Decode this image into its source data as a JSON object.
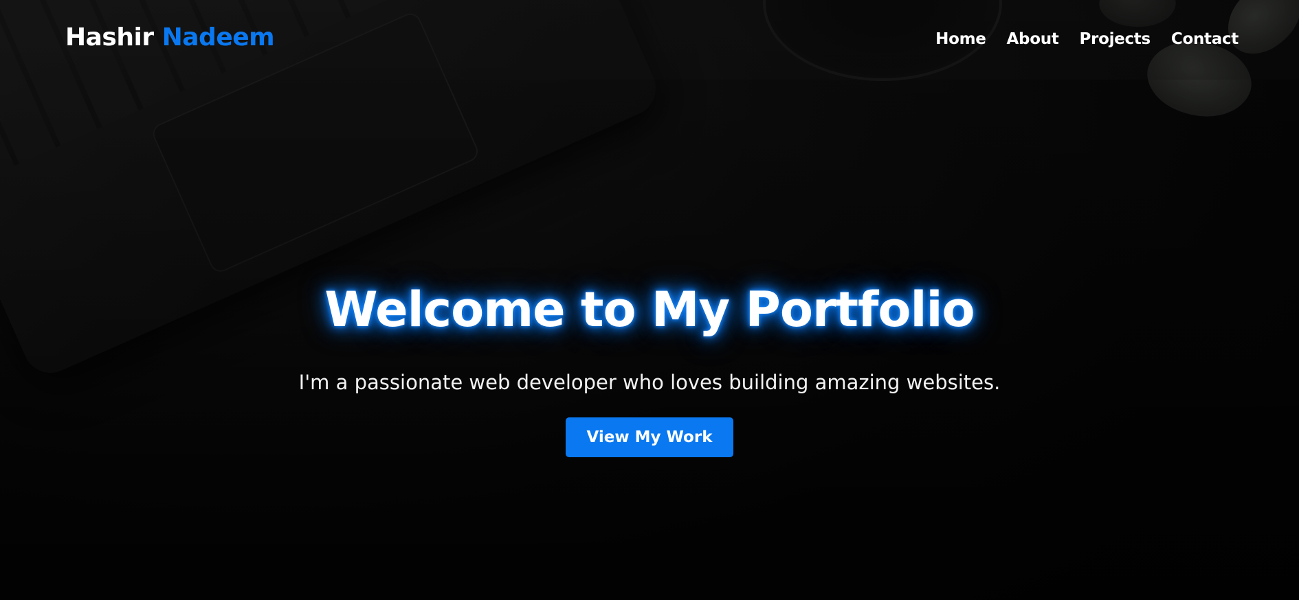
{
  "header": {
    "logo_first": "Hashir",
    "logo_second": "Nadeem",
    "nav": [
      {
        "label": "Home"
      },
      {
        "label": "About"
      },
      {
        "label": "Projects"
      },
      {
        "label": "Contact"
      }
    ]
  },
  "hero": {
    "title": "Welcome to My Portfolio",
    "subtitle": "I'm a passionate web developer who loves building amazing websites.",
    "cta_label": "View My Work"
  },
  "colors": {
    "accent": "#0a78f0",
    "background": "#050505",
    "text": "#ffffff"
  }
}
